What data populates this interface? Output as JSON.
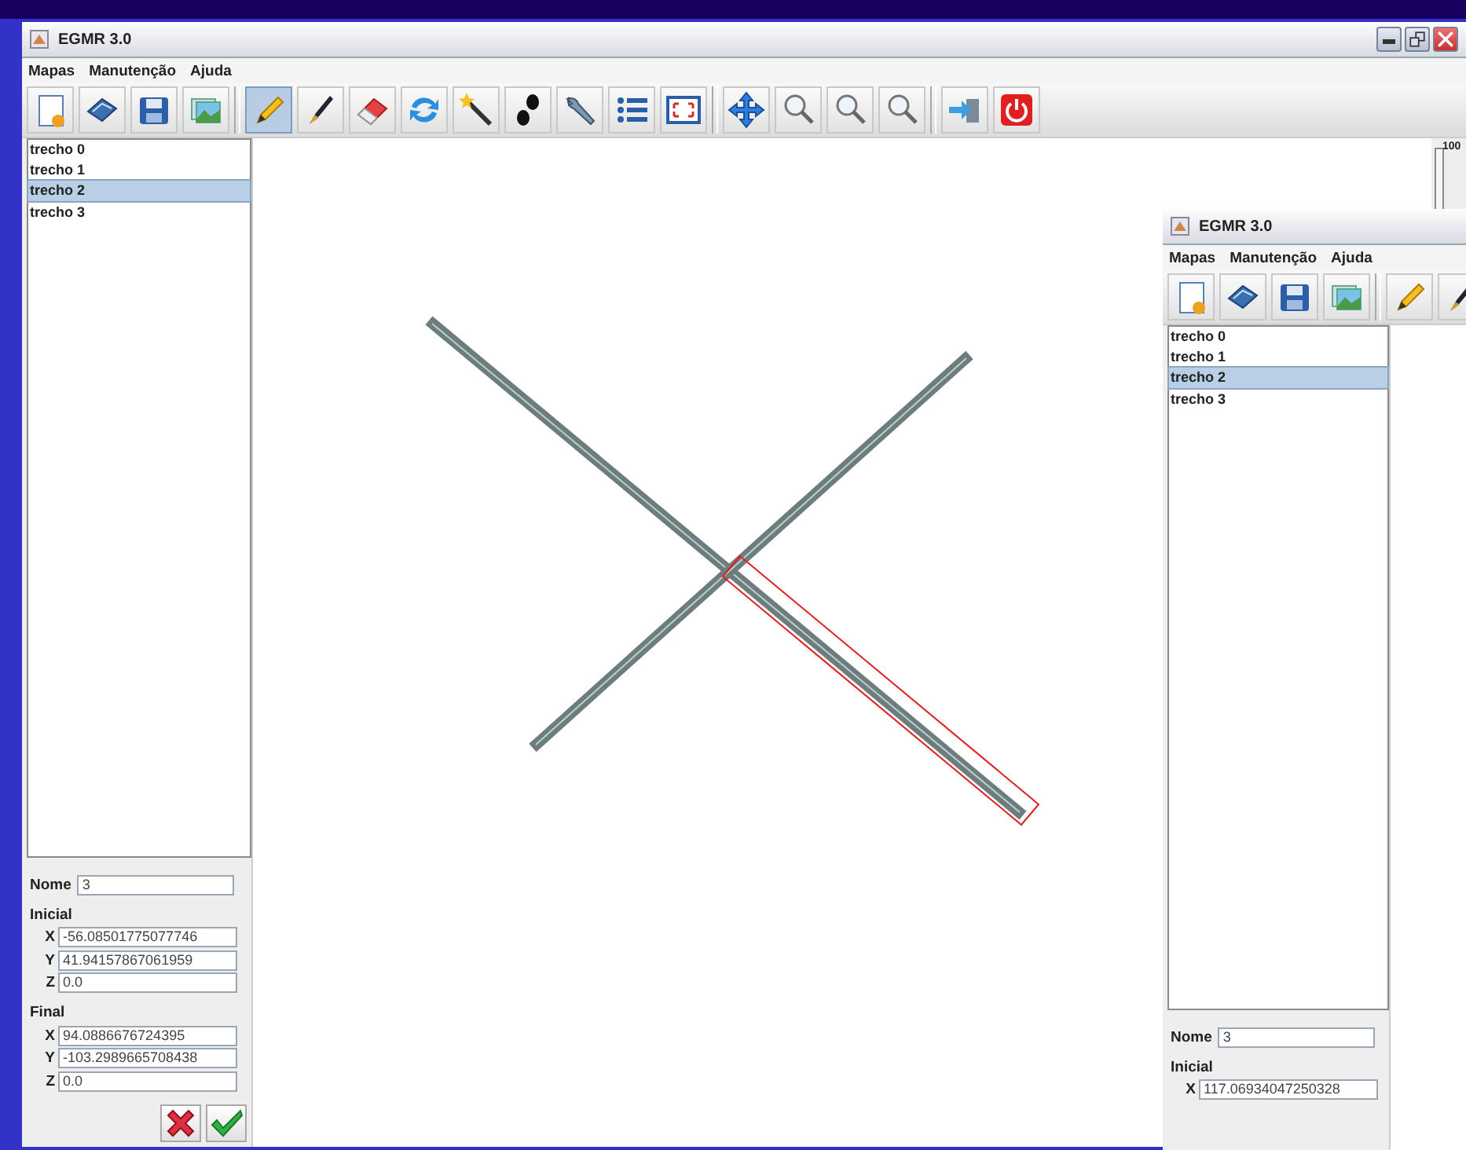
{
  "windows": [
    {
      "title": "EGMR 3.0",
      "controls": [
        {
          "kind": "minimize"
        },
        {
          "kind": "maximize"
        },
        {
          "kind": "close"
        }
      ],
      "menu": [
        "Mapas",
        "Manutenção",
        "Ajuda"
      ],
      "tools": [
        {
          "kind": "new-map",
          "selected": false
        },
        {
          "kind": "book",
          "selected": false
        },
        {
          "kind": "save",
          "selected": false
        },
        {
          "kind": "pictures",
          "selected": false
        },
        {
          "kind": "separator"
        },
        {
          "kind": "pencil",
          "selected": true
        },
        {
          "kind": "pen",
          "selected": false
        },
        {
          "kind": "eraser",
          "selected": false
        },
        {
          "kind": "refresh",
          "selected": false
        },
        {
          "kind": "wand",
          "selected": false
        },
        {
          "kind": "footprints",
          "selected": false
        },
        {
          "kind": "wrench",
          "selected": false
        },
        {
          "kind": "list",
          "selected": false
        },
        {
          "kind": "frame",
          "selected": false
        },
        {
          "kind": "separator"
        },
        {
          "kind": "move",
          "selected": false
        },
        {
          "kind": "zoom",
          "selected": false
        },
        {
          "kind": "zoom",
          "selected": false
        },
        {
          "kind": "zoom",
          "selected": false
        },
        {
          "kind": "separator"
        },
        {
          "kind": "exit",
          "selected": false
        },
        {
          "kind": "power",
          "selected": false
        }
      ],
      "list": [
        {
          "label": "trecho 0",
          "selected": false
        },
        {
          "label": "trecho 1",
          "selected": false
        },
        {
          "label": "trecho 2",
          "selected": true
        },
        {
          "label": "trecho 3",
          "selected": false
        }
      ],
      "form": {
        "name": {
          "label": "Nome",
          "value": "3"
        },
        "groups": [
          {
            "title": "Inicial",
            "fields": [
              {
                "label": "X",
                "value": "-56.08501775077746"
              },
              {
                "label": "Y",
                "value": "41.94157867061959"
              },
              {
                "label": "Z",
                "value": "0.0"
              }
            ]
          },
          {
            "title": "Final",
            "fields": [
              {
                "label": "X",
                "value": "94.0886676724395"
              },
              {
                "label": "Y",
                "value": "-103.2989665708438"
              },
              {
                "label": "Z",
                "value": "0.0"
              }
            ]
          }
        ],
        "actions": [
          {
            "kind": "cancel"
          },
          {
            "kind": "confirm"
          }
        ]
      },
      "canvas": {
        "kind": "map"
      },
      "slider": {
        "label": "100"
      }
    },
    {
      "title": "EGMR 3.0",
      "menu": [
        "Mapas",
        "Manutenção",
        "Ajuda"
      ],
      "tools": [
        {
          "kind": "new-map",
          "selected": false
        },
        {
          "kind": "book",
          "selected": false
        },
        {
          "kind": "save",
          "selected": false
        },
        {
          "kind": "pictures",
          "selected": false
        },
        {
          "kind": "separator"
        },
        {
          "kind": "pencil",
          "selected": false
        },
        {
          "kind": "pen",
          "selected": false
        }
      ],
      "list": [
        {
          "label": "trecho 0",
          "selected": false
        },
        {
          "label": "trecho 1",
          "selected": false
        },
        {
          "label": "trecho 2",
          "selected": true
        },
        {
          "label": "trecho 3",
          "selected": false
        }
      ],
      "form": {
        "name": {
          "label": "Nome",
          "value": "3"
        },
        "groups": [
          {
            "title": "Inicial",
            "fields": [
              {
                "label": "X",
                "value": "117.06934047250328"
              }
            ]
          }
        ]
      },
      "canvas": {
        "kind": "blank"
      }
    }
  ]
}
